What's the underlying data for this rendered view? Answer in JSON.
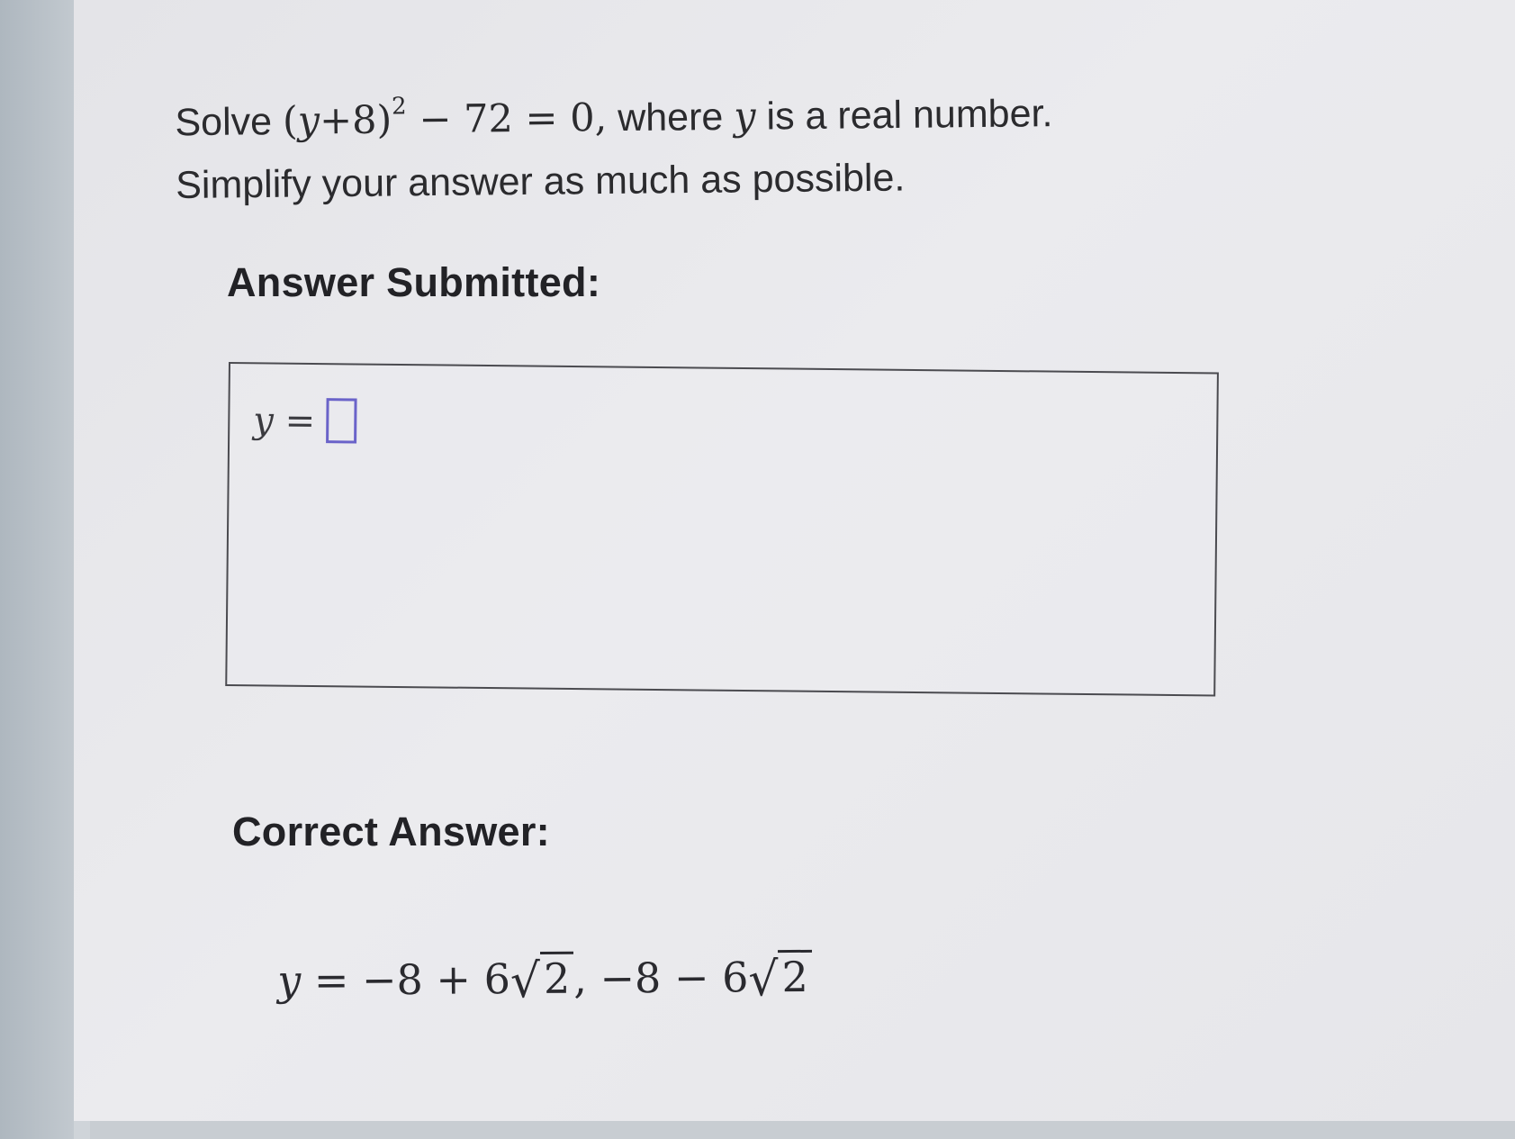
{
  "question": {
    "prefix": "Solve",
    "equation_open": "(",
    "equation_var": "y",
    "equation_plus": "+8)",
    "equation_exp": "2",
    "equation_rest": " − 72 = 0,",
    "where_text": " where ",
    "where_var": "y",
    "suffix": " is a real number.",
    "line2": "Simplify your answer as much as possible."
  },
  "submitted": {
    "label": "Answer Submitted:",
    "var": "y",
    "equals": " ="
  },
  "correct": {
    "label": "Correct Answer:",
    "var": "y",
    "eq1_prefix": " = −8 + 6",
    "sqrt1": "2",
    "separator": ", −8 − 6",
    "sqrt2": "2"
  },
  "colors": {
    "answer_slot_border": "#6a63c9"
  }
}
